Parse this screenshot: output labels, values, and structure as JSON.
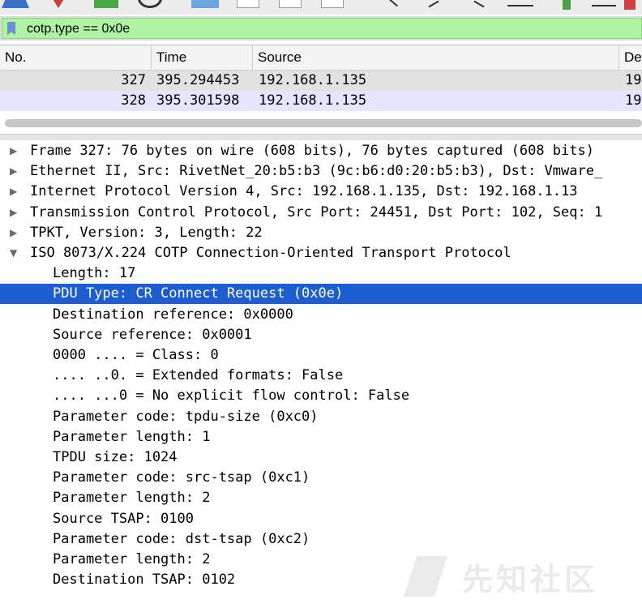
{
  "filter": {
    "value": "cotp.type == 0x0e"
  },
  "packet_list": {
    "columns": [
      "No.",
      "Time",
      "Source",
      "De"
    ],
    "rows": [
      {
        "no": "327",
        "time": "395.294453",
        "source": "192.168.1.135",
        "dest": "19"
      },
      {
        "no": "328",
        "time": "395.301598",
        "source": "192.168.1.135",
        "dest": "19"
      }
    ]
  },
  "details": {
    "rows": [
      {
        "text": "Frame 327: 76 bytes on wire (608 bits), 76 bytes captured (608 bits)",
        "level": 0,
        "arrow": "right"
      },
      {
        "text": "Ethernet II, Src: RivetNet_20:b5:b3 (9c:b6:d0:20:b5:b3), Dst: Vmware_",
        "level": 0,
        "arrow": "right"
      },
      {
        "text": "Internet Protocol Version 4, Src: 192.168.1.135, Dst: 192.168.1.13",
        "level": 0,
        "arrow": "right"
      },
      {
        "text": "Transmission Control Protocol, Src Port: 24451, Dst Port: 102, Seq: 1",
        "level": 0,
        "arrow": "right"
      },
      {
        "text": "TPKT, Version: 3, Length: 22",
        "level": 0,
        "arrow": "right"
      },
      {
        "text": "ISO 8073/X.224 COTP Connection-Oriented Transport Protocol",
        "level": 0,
        "arrow": "down"
      },
      {
        "text": "Length: 17",
        "level": 1
      },
      {
        "text": "PDU Type: CR Connect Request (0x0e)",
        "level": 1,
        "selected": true
      },
      {
        "text": "Destination reference: 0x0000",
        "level": 1
      },
      {
        "text": "Source reference: 0x0001",
        "level": 1
      },
      {
        "text": "0000 .... = Class: 0",
        "level": 1
      },
      {
        "text": ".... ..0. = Extended formats: False",
        "level": 1
      },
      {
        "text": ".... ...0 = No explicit flow control: False",
        "level": 1
      },
      {
        "text": "Parameter code: tpdu-size (0xc0)",
        "level": 1
      },
      {
        "text": "Parameter length: 1",
        "level": 1
      },
      {
        "text": "TPDU size: 1024",
        "level": 1
      },
      {
        "text": "Parameter code: src-tsap (0xc1)",
        "level": 1
      },
      {
        "text": "Parameter length: 2",
        "level": 1
      },
      {
        "text": "Source TSAP: 0100",
        "level": 1
      },
      {
        "text": "Parameter code: dst-tsap (0xc2)",
        "level": 1
      },
      {
        "text": "Parameter length: 2",
        "level": 1
      },
      {
        "text": "Destination TSAP: 0102",
        "level": 1
      }
    ]
  },
  "watermark": {
    "text": "先知社区"
  },
  "colors": {
    "filter_bg": "#aff2a4",
    "selected_row": "#1c5ed1",
    "row_alt": "#e5e5ff"
  }
}
